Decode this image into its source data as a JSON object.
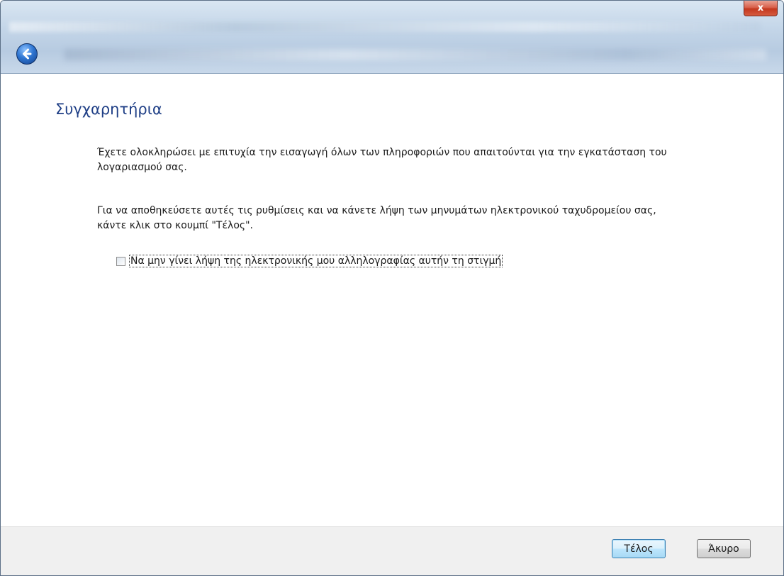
{
  "titlebar": {
    "close_label": "x",
    "back_icon": "back-arrow-icon"
  },
  "main": {
    "heading": "Συγχαρητήρια",
    "paragraph1": "Έχετε ολοκληρώσει με επιτυχία την εισαγωγή όλων των πληροφοριών που απαιτούνται για την εγκατάσταση του λογαριασμού σας.",
    "paragraph2": "Για να αποθηκεύσετε αυτές τις ρυθμίσεις και να κάνετε λήψη των μηνυμάτων ηλεκτρονικού ταχυδρομείου σας, κάντε κλικ στο κουμπί \"Τέλος\".",
    "checkbox_label": "Να μην γίνει λήψη της ηλεκτρονικής μου αλληλογραφίας αυτήν τη στιγμή",
    "checkbox_checked": false
  },
  "footer": {
    "finish_label": "Τέλος",
    "cancel_label": "Άκυρο"
  },
  "colors": {
    "heading": "#1f3f86",
    "footer_bg": "#f0f0f0",
    "close_red": "#c3381f"
  }
}
